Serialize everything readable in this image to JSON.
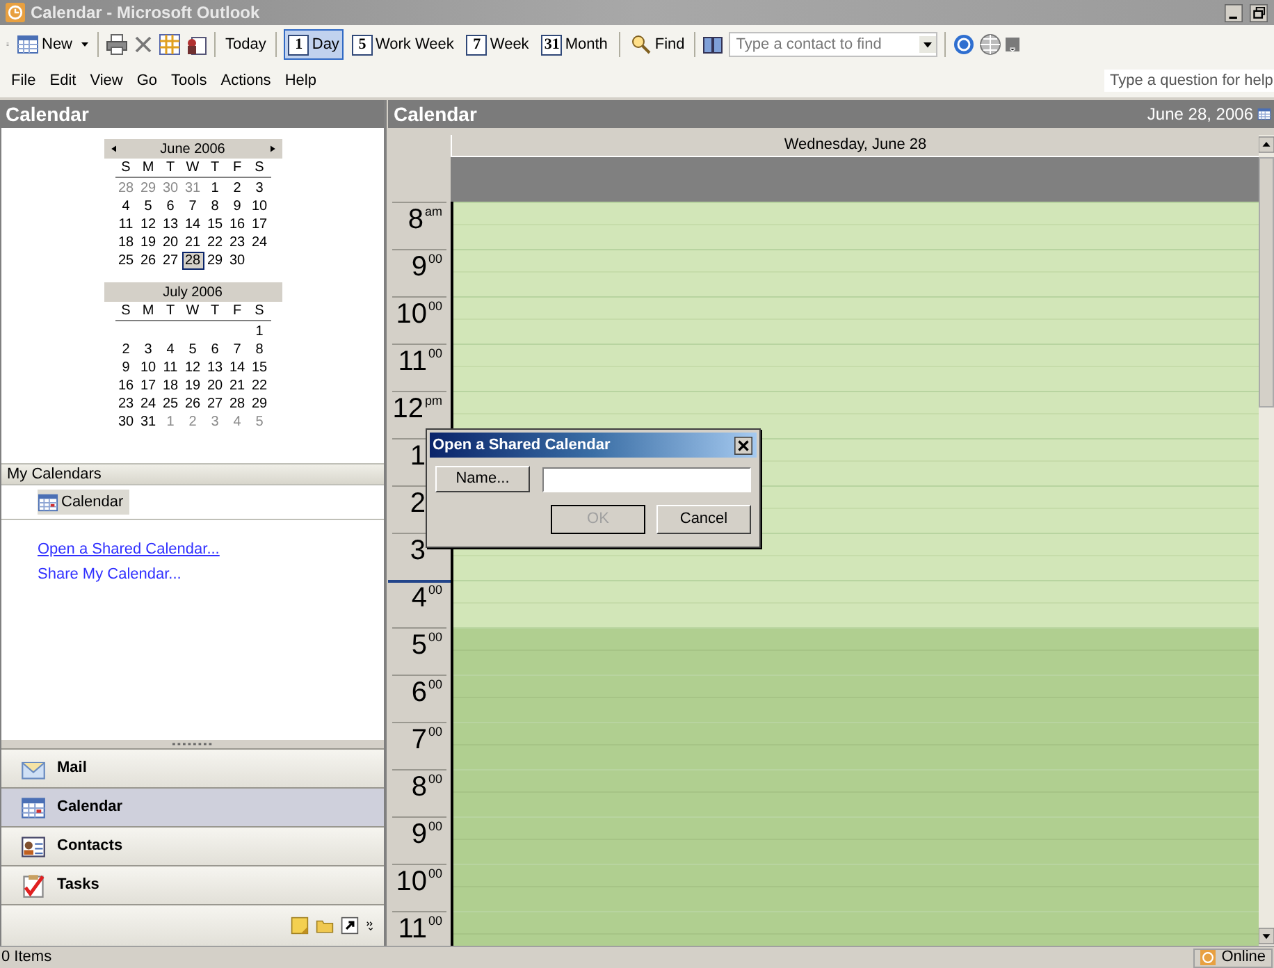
{
  "window": {
    "title": "Calendar - Microsoft Outlook"
  },
  "toolbar": [
    {
      "kind": "button",
      "label": "New",
      "dropdown": true
    },
    {
      "kind": "separator"
    },
    {
      "kind": "icon"
    },
    {
      "kind": "icon"
    },
    {
      "kind": "icon"
    },
    {
      "kind": "icon"
    },
    {
      "kind": "separator"
    },
    {
      "kind": "button",
      "label": "Today",
      "dropdown": false
    },
    {
      "kind": "separator"
    },
    {
      "kind": "view",
      "badge": "1",
      "label": "Day",
      "selected": true
    },
    {
      "kind": "view",
      "badge": "5",
      "label": "Work Week",
      "selected": false
    },
    {
      "kind": "view",
      "badge": "7",
      "label": "Week",
      "selected": false
    },
    {
      "kind": "view",
      "badge": "31",
      "label": "Month",
      "selected": false
    },
    {
      "kind": "separator"
    },
    {
      "kind": "button",
      "label": "Find",
      "dropdown": false
    },
    {
      "kind": "separator"
    },
    {
      "kind": "icon"
    },
    {
      "kind": "combo",
      "placeholder": "Type a contact to find"
    },
    {
      "kind": "separator"
    },
    {
      "kind": "icon"
    },
    {
      "kind": "icon"
    }
  ],
  "menu": [
    "File",
    "Edit",
    "View",
    "Go",
    "Tools",
    "Actions",
    "Help"
  ],
  "help_box": {
    "placeholder": "Type a question for help"
  },
  "nav_pane": {
    "title": "Calendar",
    "mini_calendars": [
      {
        "month": "June 2006",
        "prev": true,
        "next": true,
        "weekdays": [
          "S",
          "M",
          "T",
          "W",
          "T",
          "F",
          "S"
        ],
        "weeks": [
          [
            {
              "d": "28",
              "dim": true,
              "selected": false
            },
            {
              "d": "29",
              "dim": true,
              "selected": false
            },
            {
              "d": "30",
              "dim": true,
              "selected": false
            },
            {
              "d": "31",
              "dim": true,
              "selected": false
            },
            {
              "d": "1",
              "dim": false,
              "selected": false
            },
            {
              "d": "2",
              "dim": false,
              "selected": false
            },
            {
              "d": "3",
              "dim": false,
              "selected": false
            }
          ],
          [
            {
              "d": "4",
              "dim": false,
              "selected": false
            },
            {
              "d": "5",
              "dim": false,
              "selected": false
            },
            {
              "d": "6",
              "dim": false,
              "selected": false
            },
            {
              "d": "7",
              "dim": false,
              "selected": false
            },
            {
              "d": "8",
              "dim": false,
              "selected": false
            },
            {
              "d": "9",
              "dim": false,
              "selected": false
            },
            {
              "d": "10",
              "dim": false,
              "selected": false
            }
          ],
          [
            {
              "d": "11",
              "dim": false,
              "selected": false
            },
            {
              "d": "12",
              "dim": false,
              "selected": false
            },
            {
              "d": "13",
              "dim": false,
              "selected": false
            },
            {
              "d": "14",
              "dim": false,
              "selected": false
            },
            {
              "d": "15",
              "dim": false,
              "selected": false
            },
            {
              "d": "16",
              "dim": false,
              "selected": false
            },
            {
              "d": "17",
              "dim": false,
              "selected": false
            }
          ],
          [
            {
              "d": "18",
              "dim": false,
              "selected": false
            },
            {
              "d": "19",
              "dim": false,
              "selected": false
            },
            {
              "d": "20",
              "dim": false,
              "selected": false
            },
            {
              "d": "21",
              "dim": false,
              "selected": false
            },
            {
              "d": "22",
              "dim": false,
              "selected": false
            },
            {
              "d": "23",
              "dim": false,
              "selected": false
            },
            {
              "d": "24",
              "dim": false,
              "selected": false
            }
          ],
          [
            {
              "d": "25",
              "dim": false,
              "selected": false
            },
            {
              "d": "26",
              "dim": false,
              "selected": false
            },
            {
              "d": "27",
              "dim": false,
              "selected": false
            },
            {
              "d": "28",
              "dim": false,
              "selected": true
            },
            {
              "d": "29",
              "dim": false,
              "selected": false
            },
            {
              "d": "30",
              "dim": false,
              "selected": false
            }
          ]
        ]
      },
      {
        "month": "July 2006",
        "prev": false,
        "next": false,
        "weekdays": [
          "S",
          "M",
          "T",
          "W",
          "T",
          "F",
          "S"
        ],
        "weeks": [
          [
            {
              "d": "1",
              "dim": false,
              "selected": false
            }
          ],
          [
            {
              "d": "2",
              "dim": false,
              "selected": false
            },
            {
              "d": "3",
              "dim": false,
              "selected": false
            },
            {
              "d": "4",
              "dim": false,
              "selected": false
            },
            {
              "d": "5",
              "dim": false,
              "selected": false
            },
            {
              "d": "6",
              "dim": false,
              "selected": false
            },
            {
              "d": "7",
              "dim": false,
              "selected": false
            },
            {
              "d": "8",
              "dim": false,
              "selected": false
            }
          ],
          [
            {
              "d": "9",
              "dim": false,
              "selected": false
            },
            {
              "d": "10",
              "dim": false,
              "selected": false
            },
            {
              "d": "11",
              "dim": false,
              "selected": false
            },
            {
              "d": "12",
              "dim": false,
              "selected": false
            },
            {
              "d": "13",
              "dim": false,
              "selected": false
            },
            {
              "d": "14",
              "dim": false,
              "selected": false
            },
            {
              "d": "15",
              "dim": false,
              "selected": false
            }
          ],
          [
            {
              "d": "16",
              "dim": false,
              "selected": false
            },
            {
              "d": "17",
              "dim": false,
              "selected": false
            },
            {
              "d": "18",
              "dim": false,
              "selected": false
            },
            {
              "d": "19",
              "dim": false,
              "selected": false
            },
            {
              "d": "20",
              "dim": false,
              "selected": false
            },
            {
              "d": "21",
              "dim": false,
              "selected": false
            },
            {
              "d": "22",
              "dim": false,
              "selected": false
            }
          ],
          [
            {
              "d": "23",
              "dim": false,
              "selected": false
            },
            {
              "d": "24",
              "dim": false,
              "selected": false
            },
            {
              "d": "25",
              "dim": false,
              "selected": false
            },
            {
              "d": "26",
              "dim": false,
              "selected": false
            },
            {
              "d": "27",
              "dim": false,
              "selected": false
            },
            {
              "d": "28",
              "dim": false,
              "selected": false
            },
            {
              "d": "29",
              "dim": false,
              "selected": false
            }
          ],
          [
            {
              "d": "30",
              "dim": false,
              "selected": false
            },
            {
              "d": "31",
              "dim": false,
              "selected": false
            },
            {
              "d": "1",
              "dim": true,
              "selected": false
            },
            {
              "d": "2",
              "dim": true,
              "selected": false
            },
            {
              "d": "3",
              "dim": true,
              "selected": false
            },
            {
              "d": "4",
              "dim": true,
              "selected": false
            },
            {
              "d": "5",
              "dim": true,
              "selected": false
            }
          ]
        ]
      }
    ],
    "my_calendars": {
      "header": "My Calendars",
      "items": [
        {
          "label": "Calendar",
          "selected": true
        }
      ]
    },
    "links": [
      {
        "label": "Open a Shared Calendar...",
        "hover": true
      },
      {
        "label": "Share My Calendar...",
        "hover": false
      }
    ],
    "nav_buttons": [
      {
        "label": "Mail",
        "selected": false
      },
      {
        "label": "Calendar",
        "selected": true
      },
      {
        "label": "Contacts",
        "selected": false
      },
      {
        "label": "Tasks",
        "selected": false
      }
    ]
  },
  "calendar_view": {
    "title": "Calendar",
    "date": "June 28, 2006",
    "day_header": "Wednesday, June 28",
    "time_slots": [
      {
        "hour": "8",
        "suffix": "am",
        "working": true,
        "current": false
      },
      {
        "hour": "9",
        "suffix": "00",
        "working": true,
        "current": false
      },
      {
        "hour": "10",
        "suffix": "00",
        "working": true,
        "current": false
      },
      {
        "hour": "11",
        "suffix": "00",
        "working": true,
        "current": false
      },
      {
        "hour": "12",
        "suffix": "pm",
        "working": true,
        "current": false
      },
      {
        "hour": "1",
        "working": true,
        "current": false
      },
      {
        "hour": "2",
        "working": true,
        "current": false
      },
      {
        "hour": "3",
        "working": true,
        "current": false
      },
      {
        "hour": "4",
        "suffix": "00",
        "working": true,
        "current": true
      },
      {
        "hour": "5",
        "suffix": "00",
        "working": false,
        "current": false
      },
      {
        "hour": "6",
        "suffix": "00",
        "working": false,
        "current": false
      },
      {
        "hour": "7",
        "suffix": "00",
        "working": false,
        "current": false
      },
      {
        "hour": "8",
        "suffix": "00",
        "working": false,
        "current": false
      },
      {
        "hour": "9",
        "suffix": "00",
        "working": false,
        "current": false
      },
      {
        "hour": "10",
        "suffix": "00",
        "working": false,
        "current": false
      },
      {
        "hour": "11",
        "suffix": "00",
        "working": false,
        "current": false
      }
    ]
  },
  "dialog": {
    "title": "Open a Shared Calendar",
    "name_button": "Name...",
    "buttons": [
      {
        "label": "OK",
        "disabled": true
      },
      {
        "label": "Cancel",
        "disabled": false
      }
    ]
  },
  "status_bar": {
    "text": "0 Items",
    "online": "Online"
  }
}
